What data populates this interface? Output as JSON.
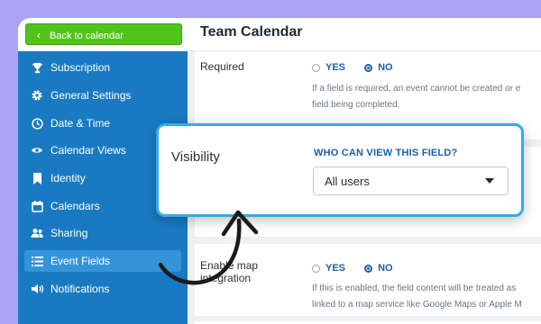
{
  "header": {
    "back_label": "Back to calendar",
    "title": "Team Calendar"
  },
  "sidebar": {
    "items": [
      {
        "label": "Subscription",
        "icon": "trophy-icon"
      },
      {
        "label": "General Settings",
        "icon": "gear-icon"
      },
      {
        "label": "Date & Time",
        "icon": "clock-icon"
      },
      {
        "label": "Calendar Views",
        "icon": "eye-icon"
      },
      {
        "label": "Identity",
        "icon": "bookmark-icon"
      },
      {
        "label": "Calendars",
        "icon": "calendar-icon"
      },
      {
        "label": "Sharing",
        "icon": "users-icon"
      },
      {
        "label": "Event Fields",
        "icon": "list-icon",
        "active": true
      },
      {
        "label": "Notifications",
        "icon": "speaker-icon"
      }
    ]
  },
  "required": {
    "label": "Required",
    "yes": "YES",
    "no": "NO",
    "selected": "NO",
    "help_line1": "If a field is required, an event cannot be created or e",
    "help_line2": "field being completed."
  },
  "visibility": {
    "label": "Visibility",
    "question": "WHO CAN VIEW THIS FIELD?",
    "value": "All users"
  },
  "map": {
    "label_line1": "Enable map",
    "label_line2": "integration",
    "yes": "YES",
    "no": "NO",
    "selected": "NO",
    "help_line1": "If this is enabled, the field content will be treated as",
    "help_line2": "linked to a map service like Google Maps or Apple M"
  },
  "colors": {
    "sidebar": "#1a7ac1",
    "accent_green": "#52c41a",
    "highlight_border": "#36a9e8",
    "background": "#a9a4f4"
  }
}
